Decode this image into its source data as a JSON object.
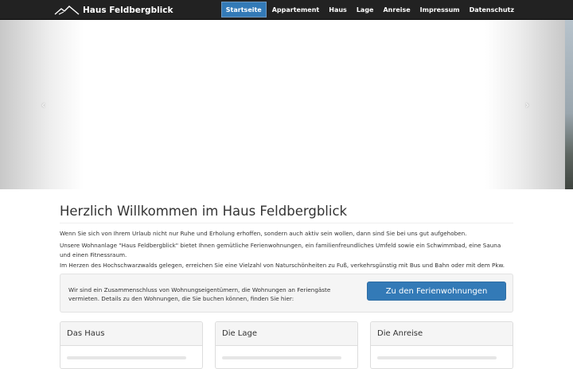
{
  "navbar": {
    "brand_icon": "mountain-logo-icon",
    "brand": "Haus Feldbergblick",
    "items": [
      {
        "label": "Startseite",
        "active": true
      },
      {
        "label": "Appartement",
        "active": false
      },
      {
        "label": "Haus",
        "active": false
      },
      {
        "label": "Lage",
        "active": false
      },
      {
        "label": "Anreise",
        "active": false
      },
      {
        "label": "Impressum",
        "active": false
      },
      {
        "label": "Datenschutz",
        "active": false
      }
    ],
    "colors": {
      "background": "#222222",
      "active": "#337ab7"
    }
  },
  "carousel": {
    "prev_glyph": "‹",
    "next_glyph": "›"
  },
  "main": {
    "title": "Herzlich Willkommen im Haus Feldbergblick",
    "paragraphs": [
      "Wenn Sie sich von Ihrem Urlaub nicht nur Ruhe und Erholung erhoffen, sondern auch aktiv sein wollen, dann sind Sie bei uns gut aufgehoben.",
      "Unsere Wohnanlage \"Haus Feldbergblick\" bietet Ihnen gemütliche Ferienwohnungen, ein familienfreundliches Umfeld sowie ein Schwimmbad, eine Sauna und einen Fitnessraum.",
      "Im Herzen des Hochschwarzwalds gelegen, erreichen Sie eine Vielzahl von Naturschönheiten zu Fuß, verkehrsgünstig mit Bus und Bahn oder mit dem Pkw."
    ],
    "well": {
      "text": "Wir sind ein Zusammenschluss von Wohnungseigentümern, die Wohnungen an Feriengäste vermieten. Details zu den Wohnungen, die Sie buchen können, finden Sie hier:",
      "button": "Zu den Ferienwohnungen"
    },
    "panels": [
      {
        "heading": "Das Haus"
      },
      {
        "heading": "Die Lage"
      },
      {
        "heading": "Die Anreise"
      }
    ]
  }
}
